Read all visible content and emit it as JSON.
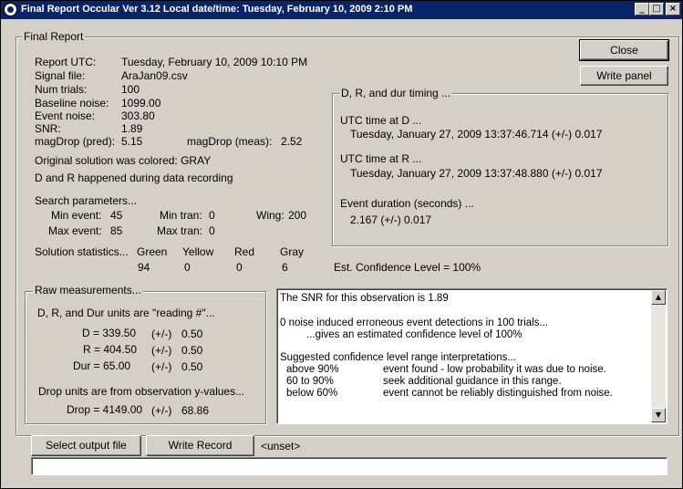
{
  "window": {
    "title": "Final Report Occular Ver 3.12  Local date/time:  Tuesday, February 10, 2009  2:10 PM",
    "minimize": "_",
    "maximize": "□",
    "close": "×"
  },
  "final_report": {
    "group_label": "Final Report",
    "report_utc_label": "Report UTC:",
    "report_utc_value": "Tuesday, February 10, 2009 10:10 PM",
    "signal_file_label": "Signal file:",
    "signal_file_value": "AraJan09.csv",
    "num_trials_label": "Num trials:",
    "num_trials_value": "100",
    "baseline_noise_label": "Baseline noise:",
    "baseline_noise_value": "1099.00",
    "event_noise_label": "Event noise:",
    "event_noise_value": "303.80",
    "snr_label": "SNR:",
    "snr_value": "1.89",
    "magdrop_pred_label": "magDrop (pred):",
    "magdrop_pred_value": "5.15",
    "magdrop_meas_label": "magDrop (meas):",
    "magdrop_meas_value": "2.52",
    "original_solution": "Original solution was colored:  GRAY",
    "d_and_r_happened": "D and R happened during data recording",
    "search_params_label": "Search parameters...",
    "min_event_label": "Min event:",
    "min_event_value": "45",
    "min_tran_label": "Min tran:",
    "min_tran_value": "0",
    "wing_label": "Wing:",
    "wing_value": "200",
    "max_event_label": "Max event:",
    "max_event_value": "85",
    "max_tran_label": "Max tran:",
    "max_tran_value": "0",
    "solution_stats_label": "Solution statistics...",
    "stats_headers": [
      "Green",
      "Yellow",
      "Red",
      "Gray"
    ],
    "stats_values": [
      "94",
      "0",
      "0",
      "6"
    ],
    "confidence_level": "Est. Confidence Level = 100%"
  },
  "buttons": {
    "close": "Close",
    "write_panel": "Write panel",
    "select_output_file": "Select output file",
    "write_record": "Write Record"
  },
  "timing": {
    "group_label": "D, R, and dur timing ...",
    "utc_d_label": "UTC time at D ...",
    "utc_d_value": "Tuesday, January 27, 2009 13:37:46.714  (+/-)  0.017",
    "utc_r_label": "UTC time at R ...",
    "utc_r_value": "Tuesday, January 27, 2009 13:37:48.880  (+/-)  0.017",
    "duration_label": "Event duration (seconds) ...",
    "duration_value": "2.167  (+/-)  0.017"
  },
  "raw": {
    "group_label": "Raw measurements...",
    "units_note": "D, R, and Dur units are \"reading #\"...",
    "d_label": "D = 339.50",
    "d_pm": "(+/-)",
    "d_err": "0.50",
    "r_label": "R = 404.50",
    "r_pm": "(+/-)",
    "r_err": "0.50",
    "dur_label": "Dur = 65.00",
    "dur_pm": "(+/-)",
    "dur_err": "0.50",
    "drop_units_note": "Drop units are from observation y-values...",
    "drop_label": "Drop = 4149.00",
    "drop_pm": "(+/-)",
    "drop_err": "68.86"
  },
  "notes": {
    "line1": "The SNR for this observation is 1.89",
    "line2": "0 noise induced erroneous event detections in 100 trials...",
    "line3": "...gives an estimated confidence level of 100%",
    "line4": "Suggested confidence level range interpretations...",
    "rows": [
      {
        "range": "above 90%",
        "text": "event found - low probability it was due to noise."
      },
      {
        "range": "60 to 90%",
        "text": "seek additional guidance in this range."
      },
      {
        "range": "below 60%",
        "text": "event cannot be reliably distinguished from noise."
      }
    ]
  },
  "output_file": "<unset>",
  "status_text": ""
}
